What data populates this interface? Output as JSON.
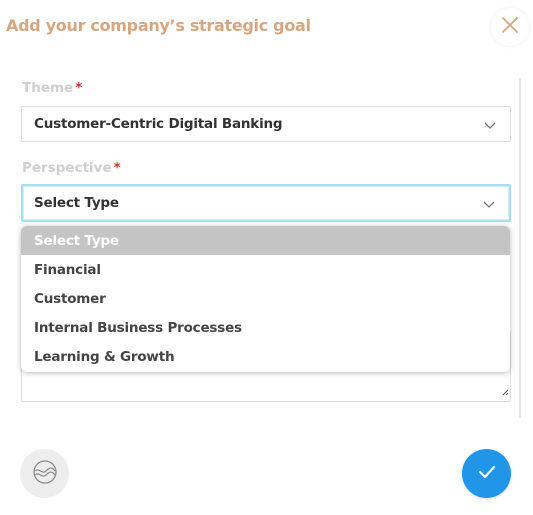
{
  "modal": {
    "title": "Add your company’s strategic goal",
    "close_icon": "close-icon"
  },
  "form": {
    "theme": {
      "label": "Theme",
      "required_mark": "*",
      "value": "Customer-Centric Digital Banking"
    },
    "perspective": {
      "label": "Perspective",
      "required_mark": "*",
      "value": "Select Type",
      "options": [
        "Select Type",
        "Financial",
        "Customer",
        "Internal Business Processes",
        "Learning & Growth"
      ],
      "highlighted_option": "Select Type"
    },
    "description": {
      "value": ""
    }
  },
  "footer": {
    "logo_icon": "wave-logo-icon",
    "submit_icon": "checkmark-icon"
  },
  "colors": {
    "title": "#d6a681",
    "close": "#d6a681",
    "required": "#c0392b",
    "focus_border": "#a9dcf2",
    "submit": "#2196e8",
    "highlight_option": "#c4c4c4"
  }
}
